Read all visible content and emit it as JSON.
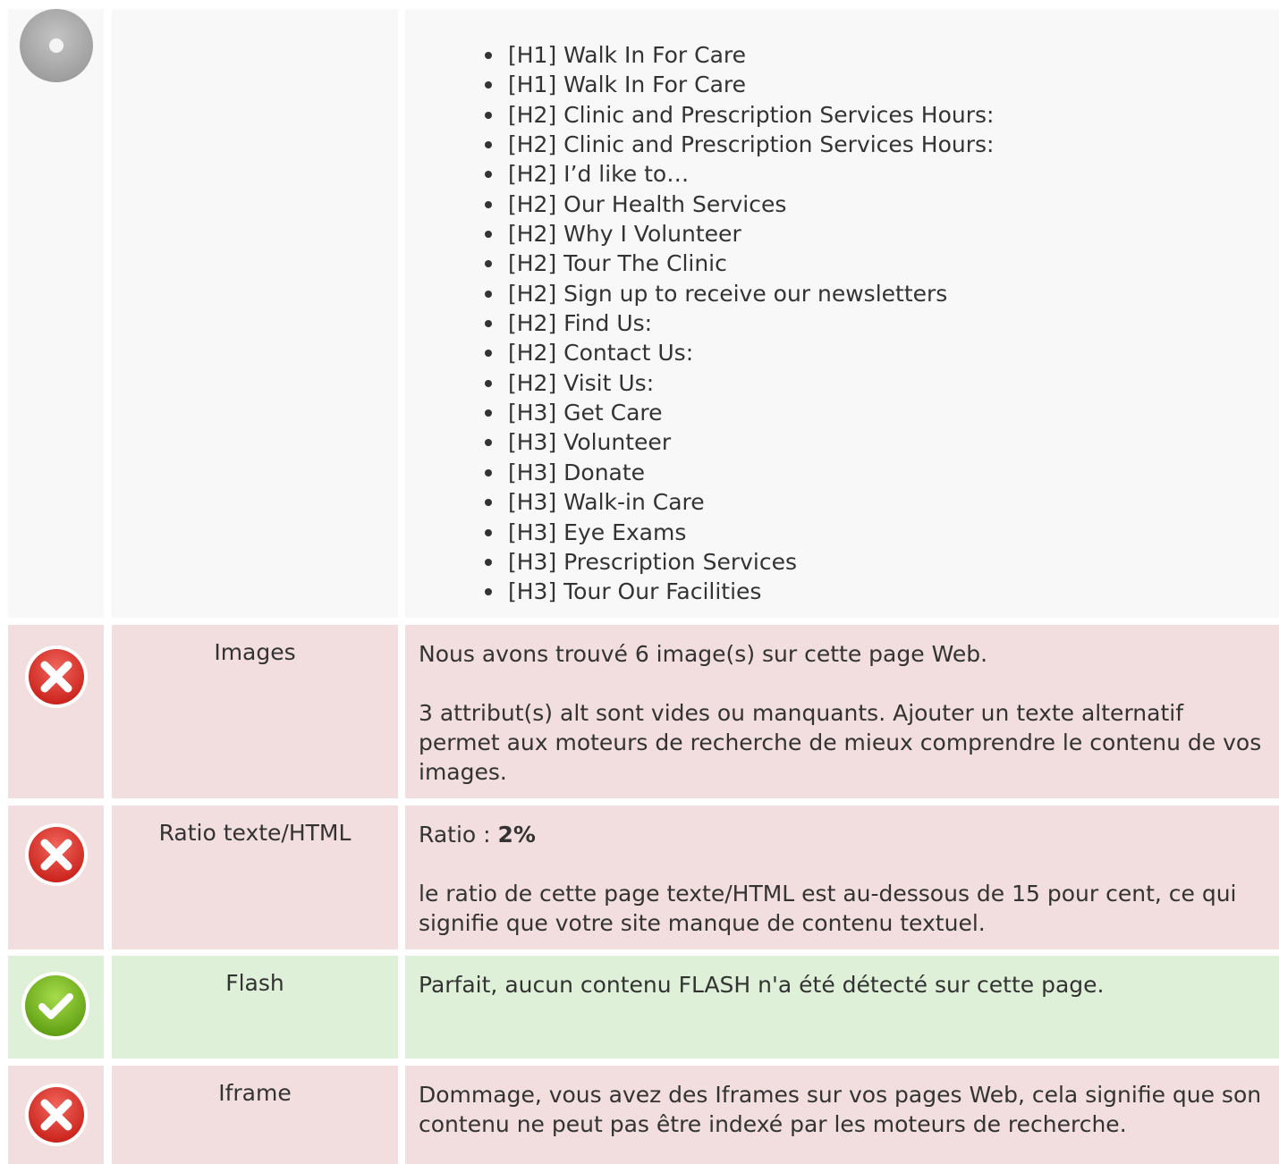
{
  "headings_section": {
    "status_icon": "neutral-circle-icon",
    "items": [
      "[H1] Walk In For Care",
      "[H1] Walk In For Care",
      "[H2] Clinic and Prescription Services Hours:",
      "[H2] Clinic and Prescription Services Hours:",
      "[H2] I’d like to…",
      "[H2] Our Health Services",
      "[H2] Why I Volunteer",
      "[H2] Tour The Clinic",
      "[H2] Sign up to receive our newsletters",
      "[H2] Find Us:",
      "[H2] Contact Us:",
      "[H2] Visit Us:",
      "[H3] Get Care",
      "[H3] Volunteer",
      "[H3] Donate",
      "[H3] Walk-in Care",
      "[H3] Eye Exams",
      "[H3] Prescription Services",
      "[H3] Tour Our Facilities"
    ]
  },
  "images": {
    "status_icon": "error-x-icon",
    "label": "Images",
    "line1": "Nous avons trouvé 6 image(s) sur cette page Web.",
    "line2": "3 attribut(s) alt sont vides ou manquants. Ajouter un texte alternatif permet aux moteurs de recherche de mieux comprendre le contenu de vos images."
  },
  "ratio": {
    "status_icon": "error-x-icon",
    "label": "Ratio texte/HTML",
    "ratio_prefix": "Ratio : ",
    "ratio_value": "2%",
    "line2": "le ratio de cette page texte/HTML est au-dessous de 15 pour cent, ce qui signifie que votre site manque de contenu textuel."
  },
  "flash": {
    "status_icon": "success-check-icon",
    "label": "Flash",
    "line1": "Parfait, aucun contenu FLASH n'a été détecté sur cette page."
  },
  "iframe": {
    "status_icon": "error-x-icon",
    "label": "Iframe",
    "line1": "Dommage, vous avez des Iframes sur vos pages Web, cela signifie que son contenu ne peut pas être indexé par les moteurs de recherche."
  },
  "colors": {
    "neutral_bg": "#f8f8f8",
    "error_bg": "#f2dede",
    "success_bg": "#dff0d8",
    "error_icon": "#d9312a",
    "success_icon": "#7bbd21",
    "neutral_icon": "#a8a8a8"
  }
}
